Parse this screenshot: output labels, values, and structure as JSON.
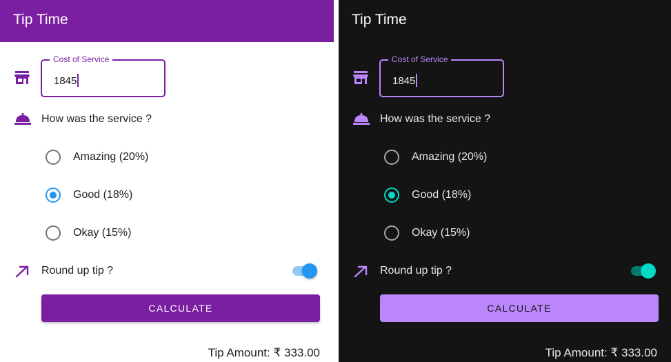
{
  "app": {
    "title": "Tip Time"
  },
  "cost_field": {
    "label": "Cost of Service",
    "value": "1845"
  },
  "service_question": "How was the service ?",
  "options": [
    {
      "label": "Amazing (20%)",
      "selected": false
    },
    {
      "label": "Good (18%)",
      "selected": true
    },
    {
      "label": "Okay (15%)",
      "selected": false
    }
  ],
  "round_up": {
    "label": "Round up tip ?",
    "on": true
  },
  "calculate_label": "CALCULATE",
  "tip_amount": "Tip Amount: ₹ 333.00",
  "icons": {
    "cost": "storefront-icon",
    "service": "room-service-icon",
    "round_up": "trending-up-icon"
  },
  "colors": {
    "light_primary": "#7b1fa2",
    "light_accent": "#2196f3",
    "dark_primary": "#bb86fc",
    "dark_accent": "#03dac5",
    "dark_background": "#141414"
  }
}
